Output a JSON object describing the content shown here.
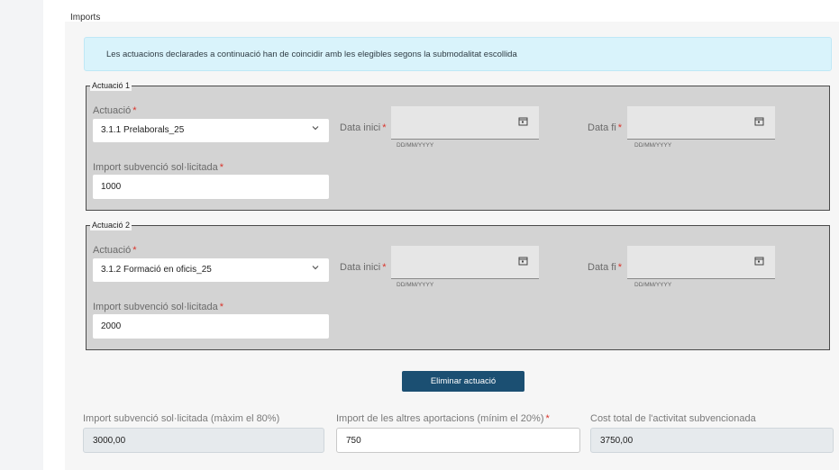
{
  "section": {
    "title": "Imports"
  },
  "info": {
    "text": "Les actuacions declarades a continuació han de coincidir amb les elegibles segons la submodalitat escollida"
  },
  "required_mark": "*",
  "actuacions": [
    {
      "legend": "Actuació 1",
      "actuacio_label": "Actuació",
      "actuacio_value": "3.1.1 Prelaborals_25",
      "data_inici_label": "Data inici",
      "data_inici_hint": "DD/MM/YYYY",
      "data_fi_label": "Data fi",
      "data_fi_hint": "DD/MM/YYYY",
      "import_label": "Import subvenció sol·licitada",
      "import_value": "1000"
    },
    {
      "legend": "Actuació 2",
      "actuacio_label": "Actuació",
      "actuacio_value": "3.1.2 Formació en oficis_25",
      "data_inici_label": "Data inici",
      "data_inici_hint": "DD/MM/YYYY",
      "data_fi_label": "Data fi",
      "data_fi_hint": "DD/MM/YYYY",
      "import_label": "Import subvenció sol·licitada",
      "import_value": "2000"
    }
  ],
  "buttons": {
    "eliminar": "Eliminar actuació"
  },
  "summary": {
    "import_label": "Import subvenció sol·licitada (màxim el 80%)",
    "import_value": "3000,00",
    "altres_label": "Import de les altres aportacions (mínim el 20%)",
    "altres_value": "750",
    "cost_label": "Cost total de l'activitat subvencionada",
    "cost_value": "3750,00"
  },
  "colors": {
    "primary_button": "#1b4f72",
    "info_bg": "#d9f3fb",
    "fieldset_bg": "#d3d3d3",
    "required": "#d9342b"
  },
  "icons": {
    "select": "chevron-down-icon",
    "date": "calendar-icon"
  }
}
